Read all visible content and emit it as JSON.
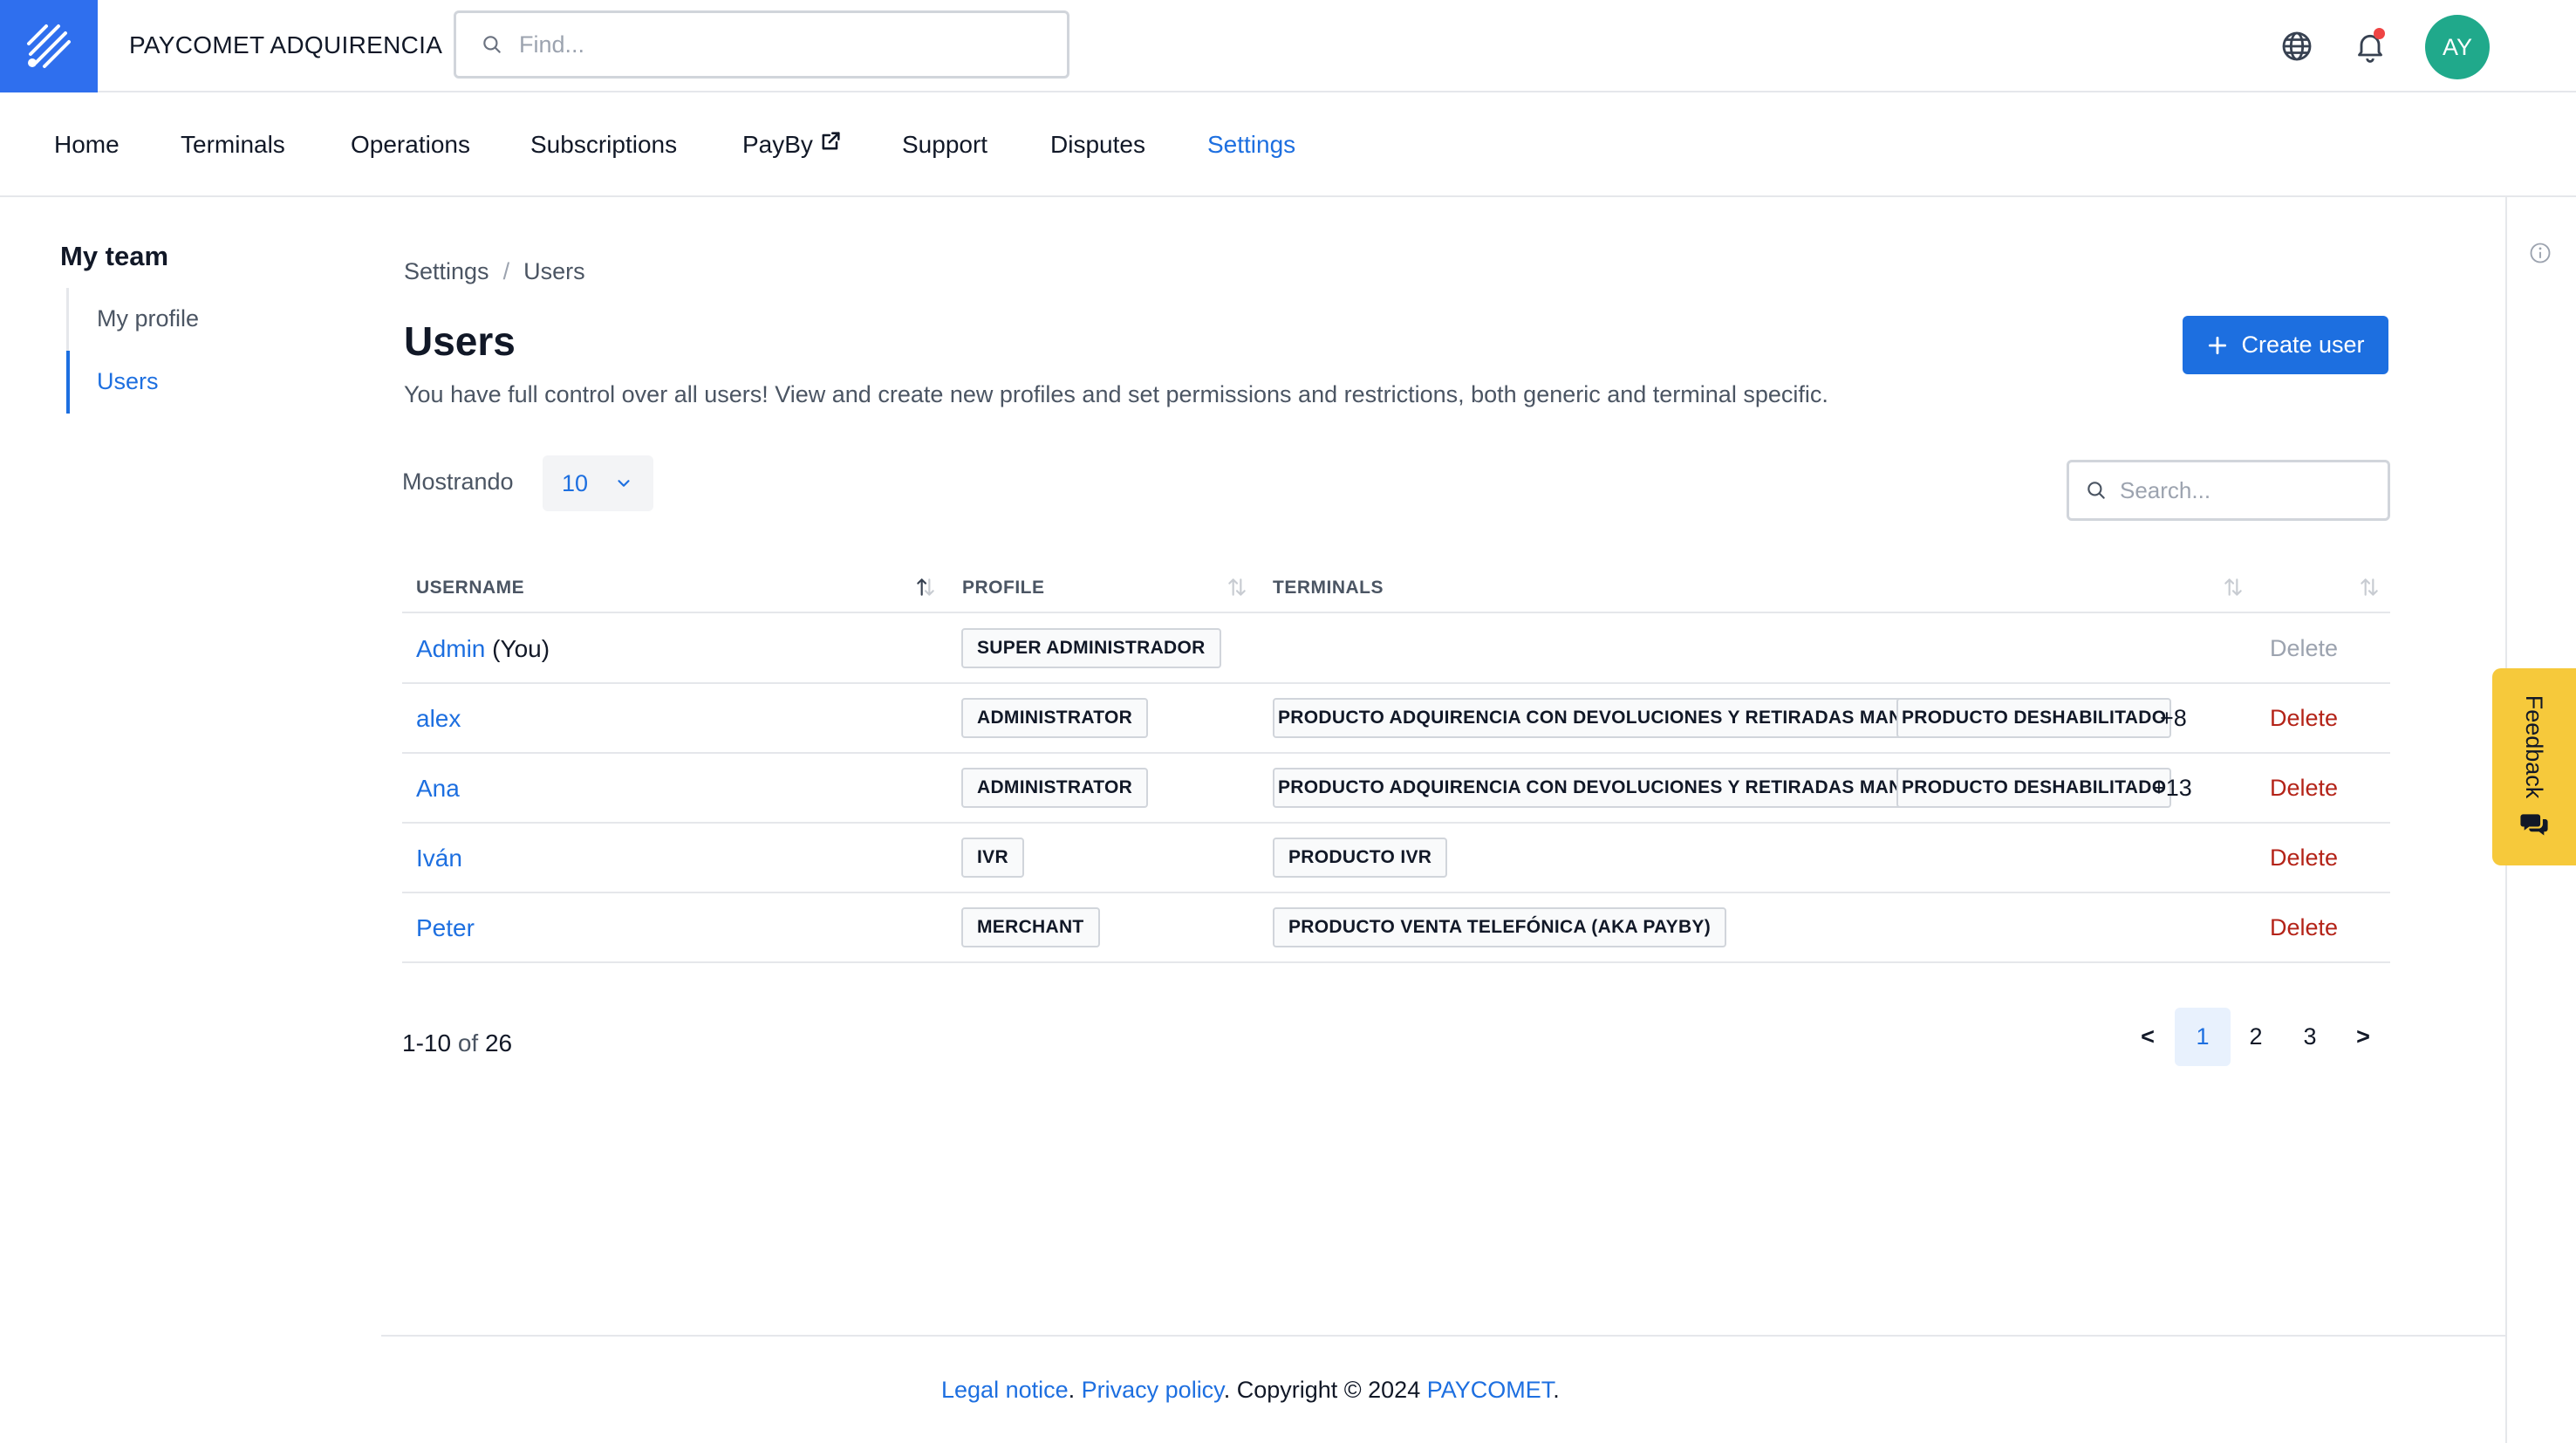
{
  "app": {
    "title": "PAYCOMET ADQUIRENCIA",
    "find_placeholder": "Find...",
    "avatar_initials": "AY",
    "accent_color": "#1d6fe0",
    "logo_color": "#2f6fee"
  },
  "nav": {
    "items": [
      {
        "label": "Home"
      },
      {
        "label": "Terminals"
      },
      {
        "label": "Operations"
      },
      {
        "label": "Subscriptions"
      },
      {
        "label": "PayBy",
        "icon": "external-link-icon"
      },
      {
        "label": "Support"
      },
      {
        "label": "Disputes"
      },
      {
        "label": "Settings",
        "active": true
      }
    ]
  },
  "sidebar": {
    "title": "My team",
    "items": [
      {
        "label": "My profile"
      },
      {
        "label": "Users",
        "active": true
      }
    ]
  },
  "breadcrumb": {
    "items": [
      "Settings",
      "Users"
    ],
    "separator": "/"
  },
  "page": {
    "title": "Users",
    "description": "You have full control over all users! View and create new profiles and set permissions and restrictions, both generic and terminal specific.",
    "create_button": "Create user"
  },
  "table_controls": {
    "showing_label": "Mostrando",
    "showing_value": "10",
    "search_placeholder": "Search..."
  },
  "table": {
    "columns": [
      "USERNAME",
      "PROFILE",
      "TERMINALS"
    ],
    "rows": [
      {
        "username": "Admin",
        "you": "(You)",
        "profile": "SUPER ADMINISTRADOR",
        "terminals": [],
        "more": "",
        "action": "Delete",
        "action_disabled": true
      },
      {
        "username": "alex",
        "you": "",
        "profile": "ADMINISTRATOR",
        "terminals": [
          "PRODUCTO ADQUIRENCIA CON DEVOLUCIONES Y RETIRADAS MANUALES",
          "PRODUCTO DESHABILITADO"
        ],
        "more": "+8",
        "action": "Delete",
        "action_disabled": false
      },
      {
        "username": "Ana",
        "you": "",
        "profile": "ADMINISTRATOR",
        "terminals": [
          "PRODUCTO ADQUIRENCIA CON DEVOLUCIONES Y RETIRADAS MANUALES",
          "PRODUCTO DESHABILITADO"
        ],
        "more": "+13",
        "action": "Delete",
        "action_disabled": false
      },
      {
        "username": "Iván",
        "you": "",
        "profile": "IVR",
        "terminals": [
          "PRODUCTO IVR"
        ],
        "more": "",
        "action": "Delete",
        "action_disabled": false
      },
      {
        "username": "Peter",
        "you": "",
        "profile": "MERCHANT",
        "terminals": [
          "PRODUCTO VENTA TELEFÓNICA (AKA PAYBY)"
        ],
        "more": "",
        "action": "Delete",
        "action_disabled": false
      }
    ]
  },
  "pagination": {
    "range": "1-10",
    "of_label": "of",
    "total": "26",
    "prev": "<",
    "next": ">",
    "pages": [
      "1",
      "2",
      "3"
    ],
    "current": "1"
  },
  "feedback": {
    "label": "Feedback"
  },
  "footer": {
    "legal": "Legal notice",
    "privacy": "Privacy policy",
    "copyright": "Copyright © 2024",
    "brand": "PAYCOMET"
  }
}
